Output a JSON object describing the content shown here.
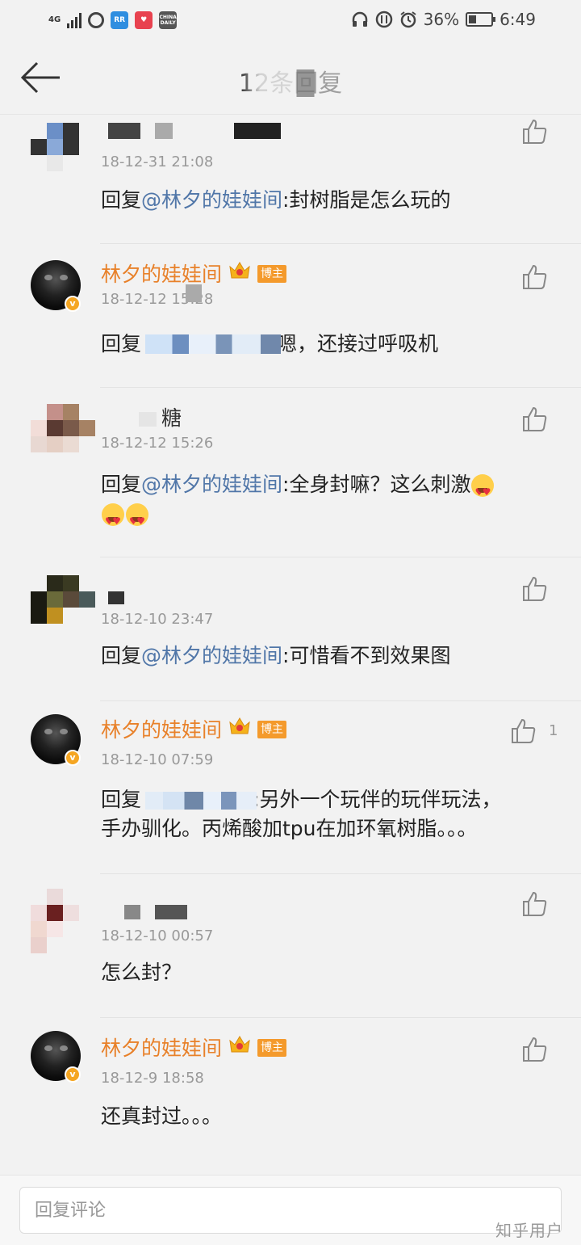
{
  "status_bar": {
    "network": "4G",
    "battery": "36%",
    "time": "6:49",
    "battery_level": 0.36,
    "apps": [
      {
        "icon": "netease-icon",
        "color": "#444444"
      },
      {
        "icon": "rr-icon",
        "label": "RR",
        "color": "#2f8ee0"
      },
      {
        "icon": "app-red-icon",
        "color": "#e8424f"
      },
      {
        "icon": "china-daily-icon",
        "label": "CHINA DAILY",
        "color": "#555555"
      }
    ]
  },
  "header": {
    "title": "12条回复"
  },
  "comments": [
    {
      "time": "18-12-31 21:08",
      "content_prefix": "回复",
      "mention": "@林夕的娃娃间",
      "content_suffix": ":封树脂是怎么玩的"
    },
    {
      "username": "林夕的娃娃间",
      "badge": "博主",
      "time": "18-12-12 15:28",
      "content_prefix": "回复",
      "content_suffix": "嗯，还接过呼吸机"
    },
    {
      "username_tail": "糖",
      "time": "18-12-12 15:26",
      "content_prefix": "回复",
      "mention": "@林夕的娃娃间",
      "content_suffix": ":全身封嘛？这么刺激"
    },
    {
      "time": "18-12-10 23:47",
      "content_prefix": "回复",
      "mention": "@林夕的娃娃间",
      "content_suffix": ":可惜看不到效果图"
    },
    {
      "username": "林夕的娃娃间",
      "badge": "博主",
      "time": "18-12-10 07:59",
      "like_count": "1",
      "content_prefix": "回复",
      "content_suffix": ":另外一个玩伴的玩伴玩法，",
      "content_line2": "手办驯化。丙烯酸加tpu在加环氧树脂。。。"
    },
    {
      "time": "18-12-10 00:57",
      "content": "怎么封？"
    },
    {
      "username": "林夕的娃娃间",
      "badge": "博主",
      "time": "18-12-9 18:58",
      "content": "还真封过。。。"
    }
  ],
  "footer": {
    "reply_placeholder": "回复评论",
    "watermark": "知乎用户"
  },
  "colors": {
    "username": "#e8812a",
    "mention": "#5076a8",
    "badge": "#f49a2c",
    "background": "#f2f2f2"
  }
}
